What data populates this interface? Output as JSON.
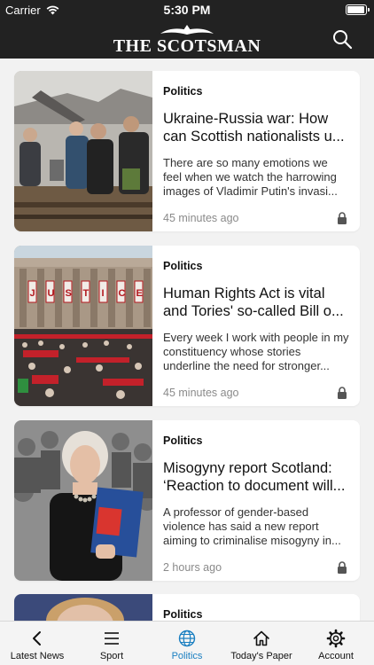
{
  "status_bar": {
    "carrier": "Carrier",
    "time": "5:30 PM"
  },
  "header": {
    "title": "THE SCOTSMAN",
    "search_icon": "search-icon"
  },
  "articles": [
    {
      "section": "Politics",
      "headline": "Ukraine-Russia war: How can Scottish nationalists u...",
      "summary": "There are so many emotions we feel when we watch the harrowing images of Vladimir Putin's invasi...",
      "time": "45 minutes ago",
      "locked": true
    },
    {
      "section": "Politics",
      "headline": "Human Rights Act is vital and Tories' so-called Bill o...",
      "summary": "Every week I work with people in my constituency whose stories underline the need for stronger...",
      "time": "45 minutes ago",
      "locked": true,
      "banner_letters": [
        "J",
        "U",
        "S",
        "T",
        "I",
        "C",
        "E"
      ]
    },
    {
      "section": "Politics",
      "headline": "Misogyny report Scotland: ‘Reaction to document will...",
      "summary": "A professor of gender-based violence has said a new report aiming to criminalise misogyny in...",
      "time": "2 hours ago",
      "locked": true
    },
    {
      "section": "Politics"
    }
  ],
  "tab_bar": {
    "tabs": [
      {
        "label": "Latest News",
        "icon": "chevron-left-icon"
      },
      {
        "label": "Sport",
        "icon": "menu-icon"
      },
      {
        "label": "Politics",
        "icon": "globe-icon",
        "active": true
      },
      {
        "label": "Today's Paper",
        "icon": "home-icon"
      },
      {
        "label": "Account",
        "icon": "gear-icon"
      }
    ]
  },
  "colors": {
    "header_bg": "#222222",
    "accent": "#1a7fc1",
    "background": "#f2f2f2"
  }
}
